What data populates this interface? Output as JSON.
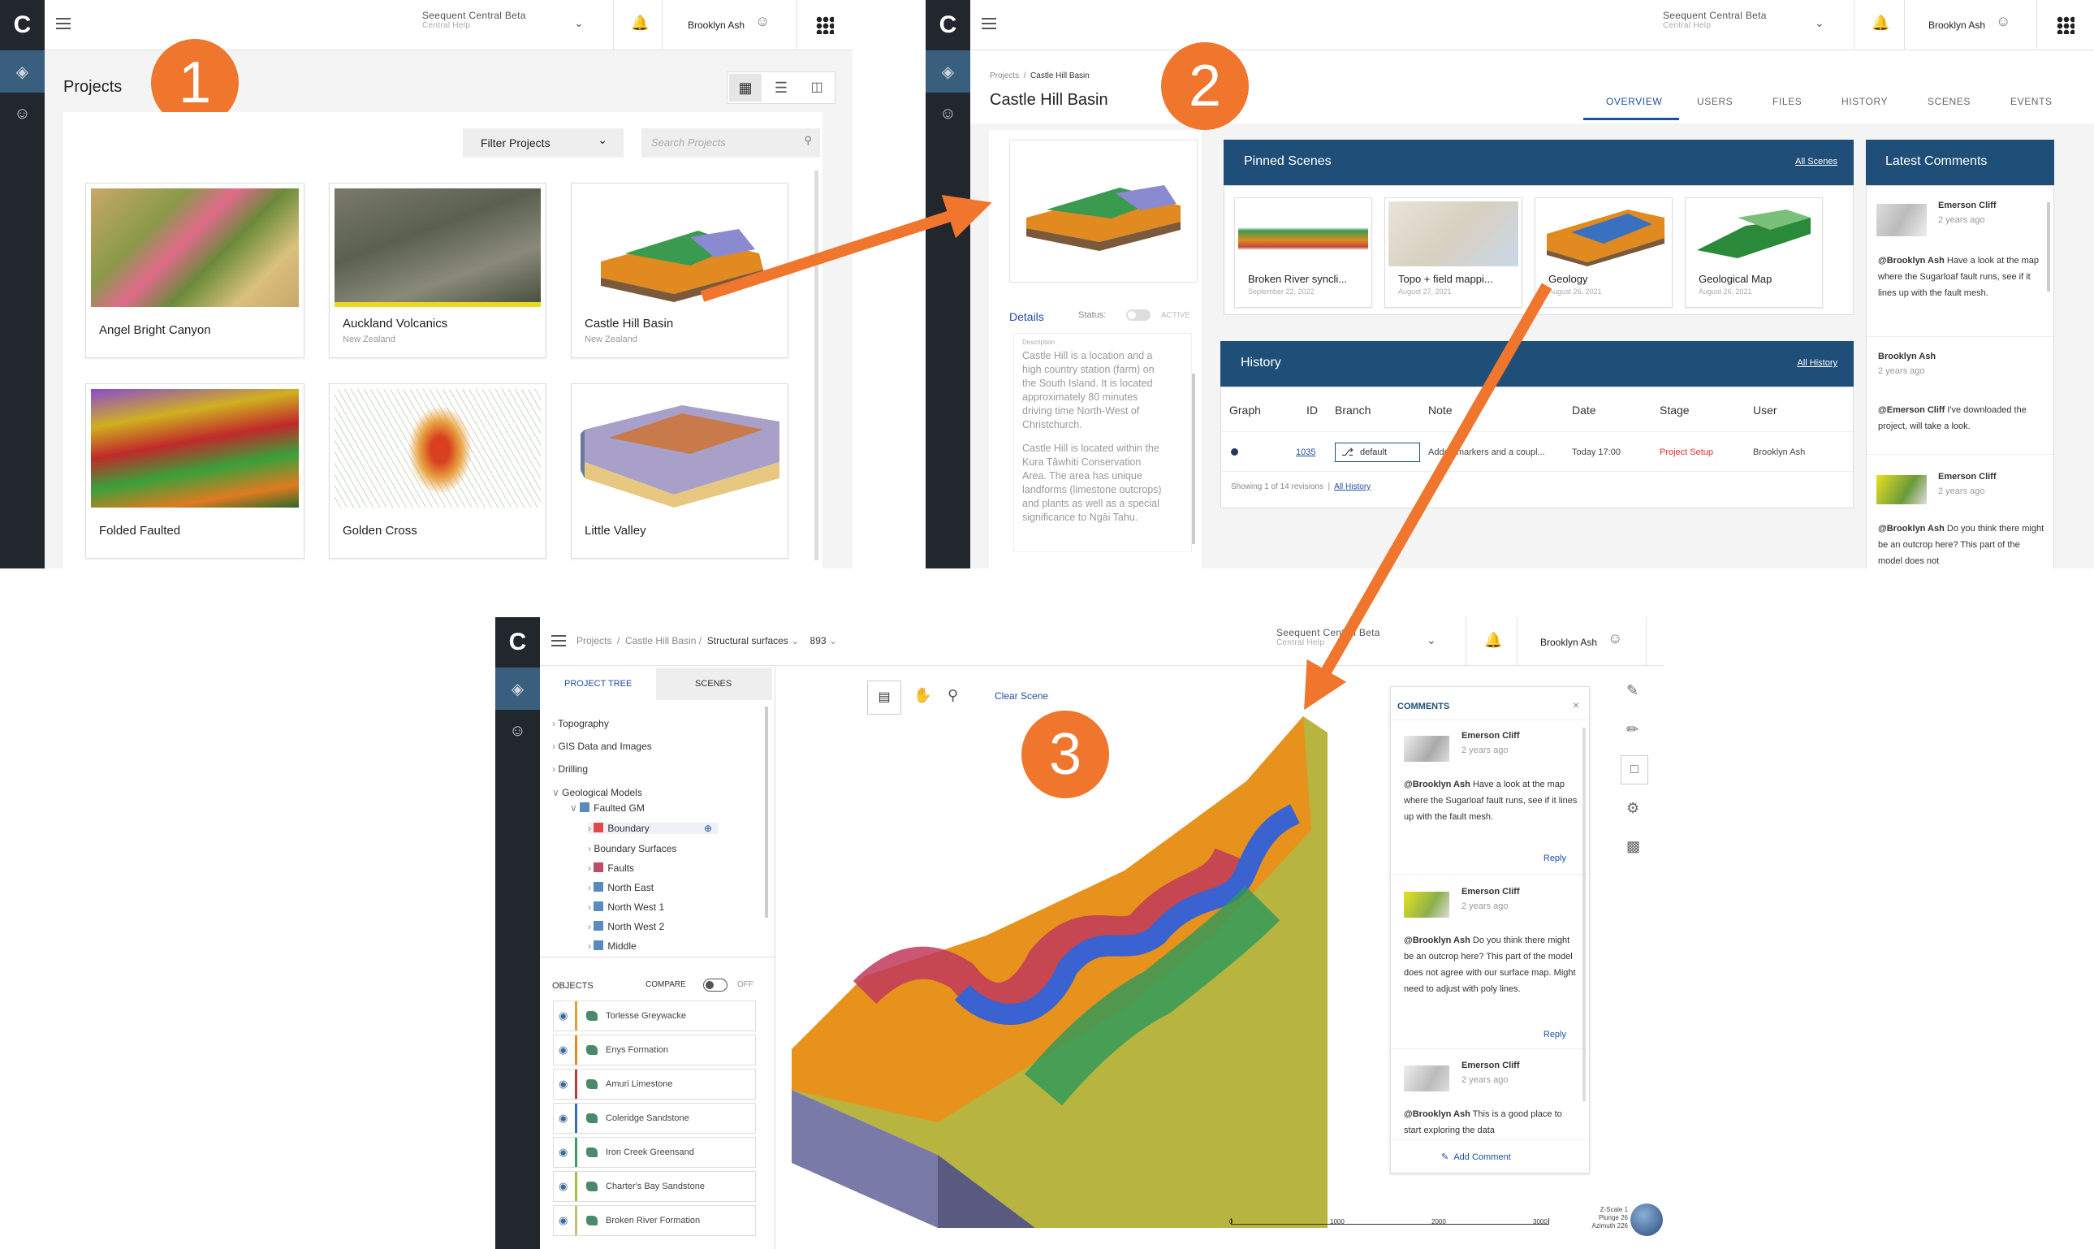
{
  "panel1": {
    "org_name": "Seequent Central Beta",
    "org_sub": "Central Help",
    "user": "Brooklyn Ash",
    "page_title": "Projects",
    "filter_label": "Filter Projects",
    "search_placeholder": "Search Projects",
    "step": "1",
    "projects": [
      {
        "name": "Angel Bright Canyon",
        "sub": ""
      },
      {
        "name": "Auckland Volcanics",
        "sub": "New Zealand"
      },
      {
        "name": "Castle Hill Basin",
        "sub": "New Zealand"
      },
      {
        "name": "Folded Faulted",
        "sub": ""
      },
      {
        "name": "Golden Cross",
        "sub": ""
      },
      {
        "name": "Little Valley",
        "sub": ""
      }
    ]
  },
  "panel2": {
    "org_name": "Seequent Central Beta",
    "org_sub": "Central Help",
    "user": "Brooklyn Ash",
    "breadcrumb_root": "Projects",
    "breadcrumb_current": "Castle Hill Basin",
    "title": "Castle Hill Basin",
    "step": "2",
    "tabs": [
      "OVERVIEW",
      "USERS",
      "FILES",
      "HISTORY",
      "SCENES",
      "EVENTS"
    ],
    "details_label": "Details",
    "status_label": "Status:",
    "status_value": "ACTIVE",
    "description_label": "Description",
    "description_1": "Castle Hill is a location and a high country station (farm) on the South Island. It is located approximately 80 minutes driving time North-West of Christchurch.",
    "description_2": "Castle Hill is located within the Kura Tāwhiti Conservation Area. The area has unique landforms (limestone outcrops) and plants as well as a special significance to Ngāi Tahu.",
    "pinned_title": "Pinned Scenes",
    "all_scenes": "All Scenes",
    "scenes": [
      {
        "name": "Broken River syncli...",
        "date": "September 22, 2022"
      },
      {
        "name": "Topo + field mappi...",
        "date": "August 27, 2021"
      },
      {
        "name": "Geology",
        "date": "August 26, 2021"
      },
      {
        "name": "Geological Map",
        "date": "August 26, 2021"
      }
    ],
    "history_title": "History",
    "all_history": "All History",
    "history_cols": [
      "Graph",
      "ID",
      "Branch",
      "Note",
      "Date",
      "Stage",
      "User"
    ],
    "history_row": {
      "id": "1035",
      "branch": "default",
      "note": "Added markers and a coupl...",
      "date": "Today 17:00",
      "stage": "Project Setup",
      "user": "Brooklyn Ash"
    },
    "showing": "Showing 1 of 14 revisions",
    "all_history_2": "All History",
    "comments_title": "Latest Comments",
    "comments": [
      {
        "author": "Emerson Cliff",
        "time": "2 years ago",
        "mention": "@Brooklyn Ash",
        "text": "Have a look at the map where the Sugarloaf fault runs, see if it lines up with the fault mesh."
      },
      {
        "author": "Brooklyn Ash",
        "time": "2 years ago",
        "mention": "@Emerson Cliff",
        "text": "I've downloaded the project, will take a look."
      },
      {
        "author": "Emerson Cliff",
        "time": "2 years ago",
        "mention": "@Brooklyn Ash",
        "text": "Do you think there might be an outcrop here? This part of the model does not"
      }
    ]
  },
  "panel3": {
    "org_name": "Seequent Central Beta",
    "org_sub": "Central Help",
    "user": "Brooklyn Ash",
    "breadcrumb": [
      "Projects",
      "Castle Hill Basin",
      "Structural surfaces",
      "893"
    ],
    "step": "3",
    "tree_tab": "PROJECT TREE",
    "scenes_tab": "SCENES",
    "tree": [
      {
        "label": "Topography",
        "level": 0
      },
      {
        "label": "GIS Data and Images",
        "level": 0
      },
      {
        "label": "Drilling",
        "level": 0
      },
      {
        "label": "Geological Models",
        "level": 0
      },
      {
        "label": "Faulted GM",
        "level": 1
      },
      {
        "label": "Boundary",
        "level": 2
      },
      {
        "label": "Boundary Surfaces",
        "level": 2
      },
      {
        "label": "Faults",
        "level": 2
      },
      {
        "label": "North East",
        "level": 2
      },
      {
        "label": "North West 1",
        "level": 2
      },
      {
        "label": "North West 2",
        "level": 2
      },
      {
        "label": "Middle",
        "level": 2
      }
    ],
    "objects_label": "OBJECTS",
    "compare_label": "COMPARE",
    "compare_state": "OFF",
    "objects": [
      {
        "name": "Torlesse Greywacke",
        "color": "#e0a030"
      },
      {
        "name": "Enys Formation",
        "color": "#e08a20"
      },
      {
        "name": "Amuri Limestone",
        "color": "#c03a3a"
      },
      {
        "name": "Coleridge Sandstone",
        "color": "#3070c0"
      },
      {
        "name": "Iron Creek Greensand",
        "color": "#3aa060"
      },
      {
        "name": "Charter's Bay Sandstone",
        "color": "#a0c040"
      },
      {
        "name": "Broken River Formation",
        "color": "#c0c070"
      }
    ],
    "clear_scene": "Clear Scene",
    "comments_title": "COMMENTS",
    "comments": [
      {
        "author": "Emerson Cliff",
        "time": "2 years ago",
        "mention": "@Brooklyn Ash",
        "text": "Have a look at the map where the Sugarloaf fault runs, see if it lines up with the fault mesh.",
        "reply": "Reply"
      },
      {
        "author": "Emerson Cliff",
        "time": "2 years ago",
        "mention": "@Brooklyn Ash",
        "text": "Do you think there might be an outcrop here? This part of the model does not agree with our surface map. Might need to adjust with poly lines.",
        "reply": "Reply"
      },
      {
        "author": "Emerson Cliff",
        "time": "2 years ago",
        "mention": "@Brooklyn Ash",
        "text": "This is a good place to start exploring the data"
      }
    ],
    "add_comment": "Add Comment",
    "scale_ticks": [
      "0",
      "1000",
      "2000",
      "3000"
    ],
    "zscale_label": "Z-Scale",
    "zscale_value": "1",
    "plunge_label": "Plunge",
    "plunge_value": "26",
    "azimuth_label": "Azimuth",
    "azimuth_value": "226"
  },
  "colors": {
    "accent": "#f0752d",
    "nav": "#22262d",
    "header_blue": "#1f4e79",
    "link": "#1f4e9e",
    "stage_red": "#e03030"
  }
}
